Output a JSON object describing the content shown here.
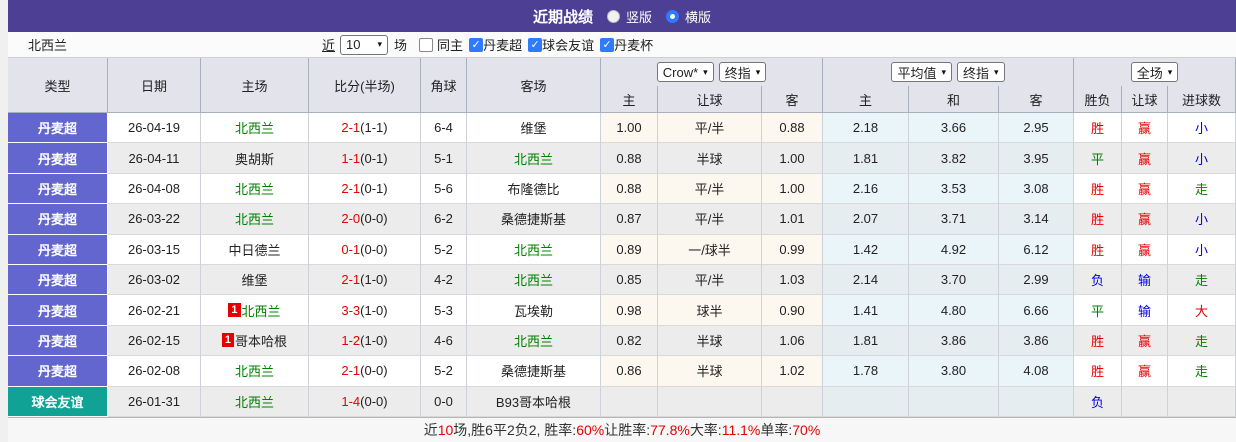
{
  "titlebar": {
    "title": "近期战绩",
    "radios": [
      {
        "label": "竖版",
        "selected": false
      },
      {
        "label": "横版",
        "selected": true
      }
    ]
  },
  "filter": {
    "team": "北西兰",
    "near_label": "近",
    "matches_value": "10",
    "games_label": "场",
    "checkboxes": [
      {
        "label": "同主",
        "checked": false
      },
      {
        "label": "丹麦超",
        "checked": true
      },
      {
        "label": "球会友谊",
        "checked": true
      },
      {
        "label": "丹麦杯",
        "checked": true
      }
    ]
  },
  "table": {
    "static_headers": [
      "类型",
      "日期",
      "主场",
      "比分(半场)",
      "角球",
      "客场"
    ],
    "selects": {
      "bookmaker": "Crow*",
      "bookmaker_final": "终指",
      "average": "平均值",
      "average_final": "终指",
      "full_match": "全场"
    },
    "sub_headers": [
      "主",
      "让球",
      "客",
      "主",
      "和",
      "客",
      "胜负",
      "让球",
      "进球数"
    ],
    "result_colors": {
      "胜": "red",
      "平": "green",
      "负": "blue",
      "赢": "red",
      "输": "blue",
      "小": "blue",
      "走": "green",
      "大": "red"
    },
    "rows": [
      {
        "type": "丹麦超",
        "type_kind": "league",
        "date": "26-04-19",
        "home": {
          "name": "北西兰",
          "self": true,
          "badge": ""
        },
        "score": {
          "ft": "2-1",
          "ht": "(1-1)"
        },
        "corner": "6-4",
        "away": {
          "name": "维堡",
          "self": false,
          "badge": ""
        },
        "odds": [
          "1.00",
          "平/半",
          "0.88"
        ],
        "avg": [
          "2.18",
          "3.66",
          "2.95"
        ],
        "results": [
          "胜",
          "赢",
          "小"
        ]
      },
      {
        "type": "丹麦超",
        "type_kind": "league",
        "date": "26-04-11",
        "home": {
          "name": "奥胡斯",
          "self": false,
          "badge": ""
        },
        "score": {
          "ft": "1-1",
          "ht": "(0-1)"
        },
        "corner": "5-1",
        "away": {
          "name": "北西兰",
          "self": true,
          "badge": ""
        },
        "odds": [
          "0.88",
          "半球",
          "1.00"
        ],
        "avg": [
          "1.81",
          "3.82",
          "3.95"
        ],
        "results": [
          "平",
          "赢",
          "小"
        ]
      },
      {
        "type": "丹麦超",
        "type_kind": "league",
        "date": "26-04-08",
        "home": {
          "name": "北西兰",
          "self": true,
          "badge": ""
        },
        "score": {
          "ft": "2-1",
          "ht": "(0-1)"
        },
        "corner": "5-6",
        "away": {
          "name": "布隆德比",
          "self": false,
          "badge": ""
        },
        "odds": [
          "0.88",
          "平/半",
          "1.00"
        ],
        "avg": [
          "2.16",
          "3.53",
          "3.08"
        ],
        "results": [
          "胜",
          "赢",
          "走"
        ]
      },
      {
        "type": "丹麦超",
        "type_kind": "league",
        "date": "26-03-22",
        "home": {
          "name": "北西兰",
          "self": true,
          "badge": ""
        },
        "score": {
          "ft": "2-0",
          "ht": "(0-0)"
        },
        "corner": "6-2",
        "away": {
          "name": "桑德捷斯基",
          "self": false,
          "badge": ""
        },
        "odds": [
          "0.87",
          "平/半",
          "1.01"
        ],
        "avg": [
          "2.07",
          "3.71",
          "3.14"
        ],
        "results": [
          "胜",
          "赢",
          "小"
        ]
      },
      {
        "type": "丹麦超",
        "type_kind": "league",
        "date": "26-03-15",
        "home": {
          "name": "中日德兰",
          "self": false,
          "badge": ""
        },
        "score": {
          "ft": "0-1",
          "ht": "(0-0)"
        },
        "corner": "5-2",
        "away": {
          "name": "北西兰",
          "self": true,
          "badge": ""
        },
        "odds": [
          "0.89",
          "一/球半",
          "0.99"
        ],
        "avg": [
          "1.42",
          "4.92",
          "6.12"
        ],
        "results": [
          "胜",
          "赢",
          "小"
        ]
      },
      {
        "type": "丹麦超",
        "type_kind": "league",
        "date": "26-03-02",
        "home": {
          "name": "维堡",
          "self": false,
          "badge": ""
        },
        "score": {
          "ft": "2-1",
          "ht": "(1-0)"
        },
        "corner": "4-2",
        "away": {
          "name": "北西兰",
          "self": true,
          "badge": ""
        },
        "odds": [
          "0.85",
          "平/半",
          "1.03"
        ],
        "avg": [
          "2.14",
          "3.70",
          "2.99"
        ],
        "results": [
          "负",
          "输",
          "走"
        ]
      },
      {
        "type": "丹麦超",
        "type_kind": "league",
        "date": "26-02-21",
        "home": {
          "name": "北西兰",
          "self": true,
          "badge": "1"
        },
        "score": {
          "ft": "3-3",
          "ht": "(1-0)"
        },
        "corner": "5-3",
        "away": {
          "name": "瓦埃勒",
          "self": false,
          "badge": ""
        },
        "odds": [
          "0.98",
          "球半",
          "0.90"
        ],
        "avg": [
          "1.41",
          "4.80",
          "6.66"
        ],
        "results": [
          "平",
          "输",
          "大"
        ]
      },
      {
        "type": "丹麦超",
        "type_kind": "league",
        "date": "26-02-15",
        "home": {
          "name": "哥本哈根",
          "self": false,
          "badge": "1"
        },
        "score": {
          "ft": "1-2",
          "ht": "(1-0)"
        },
        "corner": "4-6",
        "away": {
          "name": "北西兰",
          "self": true,
          "badge": ""
        },
        "odds": [
          "0.82",
          "半球",
          "1.06"
        ],
        "avg": [
          "1.81",
          "3.86",
          "3.86"
        ],
        "results": [
          "胜",
          "赢",
          "走"
        ]
      },
      {
        "type": "丹麦超",
        "type_kind": "league",
        "date": "26-02-08",
        "home": {
          "name": "北西兰",
          "self": true,
          "badge": ""
        },
        "score": {
          "ft": "2-1",
          "ht": "(0-0)"
        },
        "corner": "5-2",
        "away": {
          "name": "桑德捷斯基",
          "self": false,
          "badge": ""
        },
        "odds": [
          "0.86",
          "半球",
          "1.02"
        ],
        "avg": [
          "1.78",
          "3.80",
          "4.08"
        ],
        "results": [
          "胜",
          "赢",
          "走"
        ]
      },
      {
        "type": "球会友谊",
        "type_kind": "friendly",
        "date": "26-01-31",
        "home": {
          "name": "北西兰",
          "self": true,
          "badge": ""
        },
        "score": {
          "ft": "1-4",
          "ht": "(0-0)"
        },
        "corner": "0-0",
        "away": {
          "name": "B93哥本哈根",
          "self": false,
          "badge": ""
        },
        "odds": [
          "",
          "",
          ""
        ],
        "avg": [
          "",
          "",
          ""
        ],
        "results": [
          "负",
          "",
          ""
        ]
      }
    ]
  },
  "summary": {
    "segments": [
      {
        "text": "近",
        "red": false
      },
      {
        "text": "10",
        "red": true
      },
      {
        "text": "场,胜6平2负2, 胜率:",
        "red": false
      },
      {
        "text": "60%",
        "red": true
      },
      {
        "text": " 让胜率:",
        "red": false
      },
      {
        "text": "77.8%",
        "red": true
      },
      {
        "text": " 大率:",
        "red": false
      },
      {
        "text": "11.1%",
        "red": true
      },
      {
        "text": " 单率:",
        "red": false
      },
      {
        "text": "70%",
        "red": true
      }
    ]
  },
  "colors": {
    "titlebar_purple": "#4d3f94",
    "league_type_purple": "#6366cf",
    "friendly_type_teal": "#0fa295",
    "self_team_green": "#008000",
    "score_red": "#e60000",
    "result_blue": "#0000dd",
    "odds_bg_cream": "#fdf8ef",
    "avg_bg_blue": "#eaf5fa",
    "checkbox_blue": "#2f7bff"
  }
}
